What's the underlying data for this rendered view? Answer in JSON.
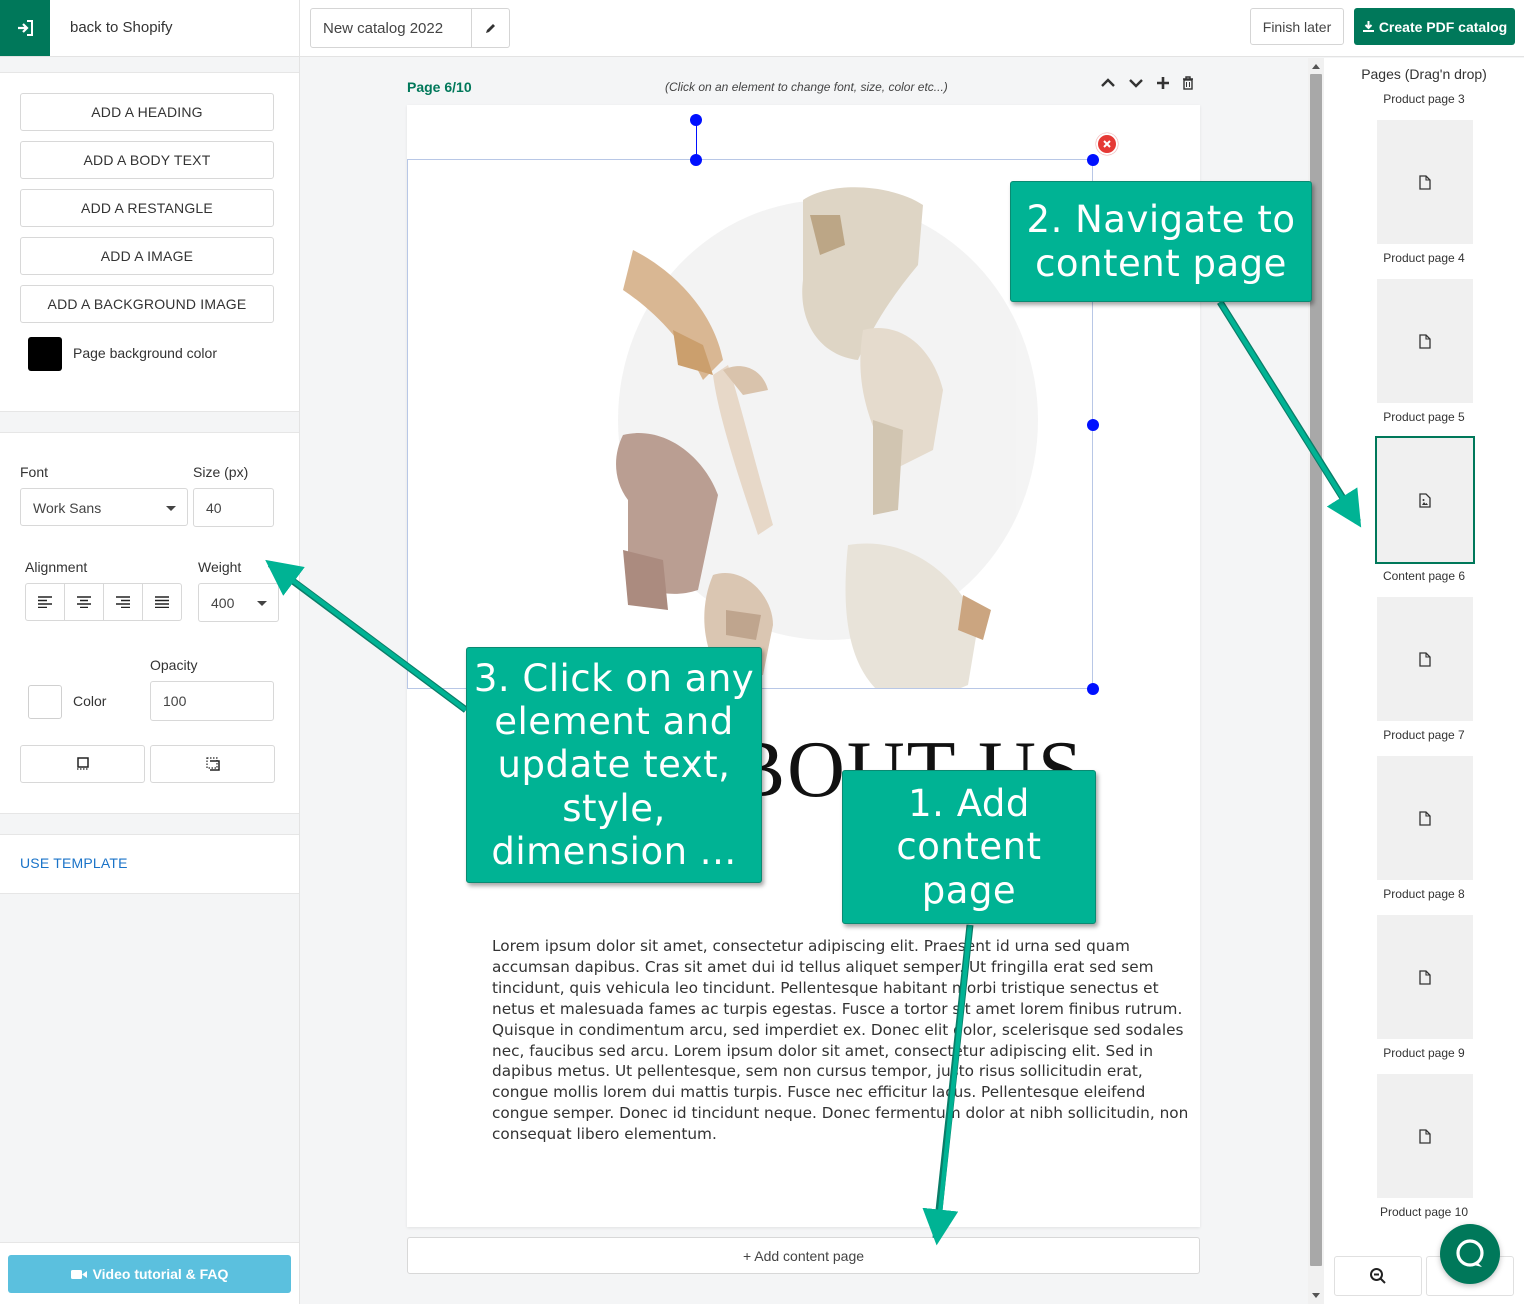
{
  "topbar": {
    "back_label": "back to Shopify",
    "catalog_name": "New catalog 2022",
    "finish_label": "Finish later",
    "create_label": "Create PDF catalog"
  },
  "elements_panel": {
    "buttons": [
      "ADD A HEADING",
      "ADD A BODY TEXT",
      "ADD A RESTANGLE",
      "ADD A IMAGE",
      "ADD A BACKGROUND IMAGE"
    ],
    "bg_color_label": "Page background color",
    "bg_color": "#000000"
  },
  "style_panel": {
    "font_label": "Font",
    "font_value": "Work Sans",
    "size_label": "Size (px)",
    "size_value": "40",
    "alignment_label": "Alignment",
    "weight_label": "Weight",
    "weight_value": "400",
    "opacity_label": "Opacity",
    "opacity_value": "100",
    "color_label": "Color",
    "text_color": "#ffffff"
  },
  "template_panel": {
    "label": "USE TEMPLATE"
  },
  "video_label": "Video tutorial & FAQ",
  "canvas": {
    "page_info": "Page 6/10",
    "hint": "(Click on an element to change font, size, color etc...)",
    "heading": "ABOUT US",
    "body": "Lorem ipsum dolor sit amet, consectetur adipiscing elit. Praesent id urna sed quam accumsan dapibus. Cras sit amet dui id tellus aliquet semper. Ut fringilla erat sed sem tincidunt, quis vehicula leo tincidunt. Pellentesque habitant morbi tristique senectus et netus et malesuada fames ac turpis egestas. Fusce a tortor sit amet lorem finibus rutrum. Quisque in condimentum arcu, sed imperdiet ex. Donec elit dolor, scelerisque sed sodales nec, faucibus sed arcu. Lorem ipsum dolor sit amet, consectetur adipiscing elit. Sed in dapibus metus. Ut pellentesque, sem non cursus tempor, justo risus sollicitudin erat, congue mollis lorem dui mattis turpis. Fusce nec efficitur lacus. Pellentesque eleifend congue semper. Donec id tincidunt neque. Donec fermentum dolor at nibh sollicitudin, non consequat libero elementum.",
    "add_page_label": "+ Add content page",
    "selection_color": "#0010ff"
  },
  "pages_panel": {
    "title": "Pages (Drag'n drop)",
    "pages": [
      {
        "label": "Product page 3",
        "type": "product"
      },
      {
        "label": "Product page 4",
        "type": "product"
      },
      {
        "label": "Product page 5",
        "type": "product"
      },
      {
        "label": "Content page 6",
        "type": "content",
        "active": true
      },
      {
        "label": "Product page 7",
        "type": "product"
      },
      {
        "label": "Product page 8",
        "type": "product"
      },
      {
        "label": "Product page 9",
        "type": "product"
      },
      {
        "label": "Product page 10",
        "type": "product"
      }
    ]
  },
  "callouts": {
    "step1": "1. Add\ncontent\npage",
    "step2": "2. Navigate to\ncontent page",
    "step3": "3. Click on any\nelement and\nupdate text,\nstyle,\ndimension ..."
  },
  "colors": {
    "brand": "#00785a",
    "callout": "#00b394",
    "link": "#1a73c8",
    "video": "#5bc0de"
  }
}
